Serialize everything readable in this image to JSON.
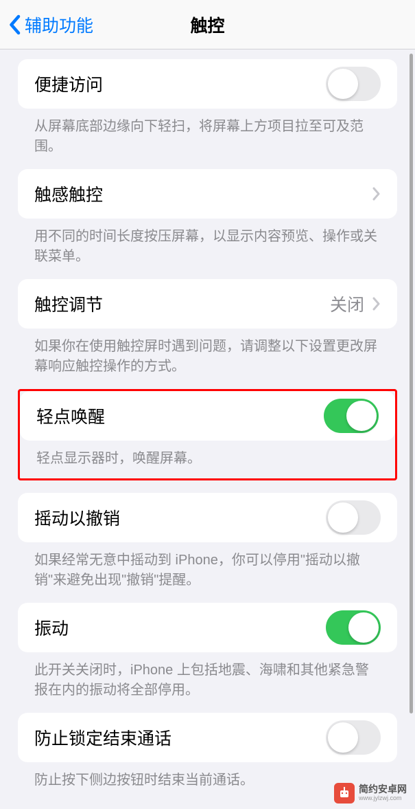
{
  "header": {
    "back_label": "辅助功能",
    "title": "触控"
  },
  "sections": {
    "reachability": {
      "label": "便捷访问",
      "enabled": false,
      "footer": "从屏幕底部边缘向下轻扫，将屏幕上方项目拉至可及范围。"
    },
    "haptic_touch": {
      "label": "触感触控",
      "footer": "用不同的时间长度按压屏幕，以显示内容预览、操作或关联菜单。"
    },
    "touch_accommodations": {
      "label": "触控调节",
      "value": "关闭",
      "footer": "如果你在使用触控屏时遇到问题，请调整以下设置更改屏幕响应触控操作的方式。"
    },
    "tap_to_wake": {
      "label": "轻点唤醒",
      "enabled": true,
      "footer": "轻点显示器时，唤醒屏幕。"
    },
    "shake_to_undo": {
      "label": "摇动以撤销",
      "enabled": false,
      "footer": "如果经常无意中摇动到 iPhone，你可以停用\"摇动以撤销\"来避免出现\"撤销\"提醒。"
    },
    "vibration": {
      "label": "振动",
      "enabled": true,
      "footer": "此开关关闭时，iPhone 上包括地震、海啸和其他紧急警报在内的振动将全部停用。"
    },
    "prevent_lock_end_call": {
      "label": "防止锁定结束通话",
      "enabled": false,
      "footer": "防止按下侧边按钮时结束当前通话。"
    }
  },
  "watermark": {
    "title": "简约安卓网",
    "url": "www.jylzwj.com"
  }
}
